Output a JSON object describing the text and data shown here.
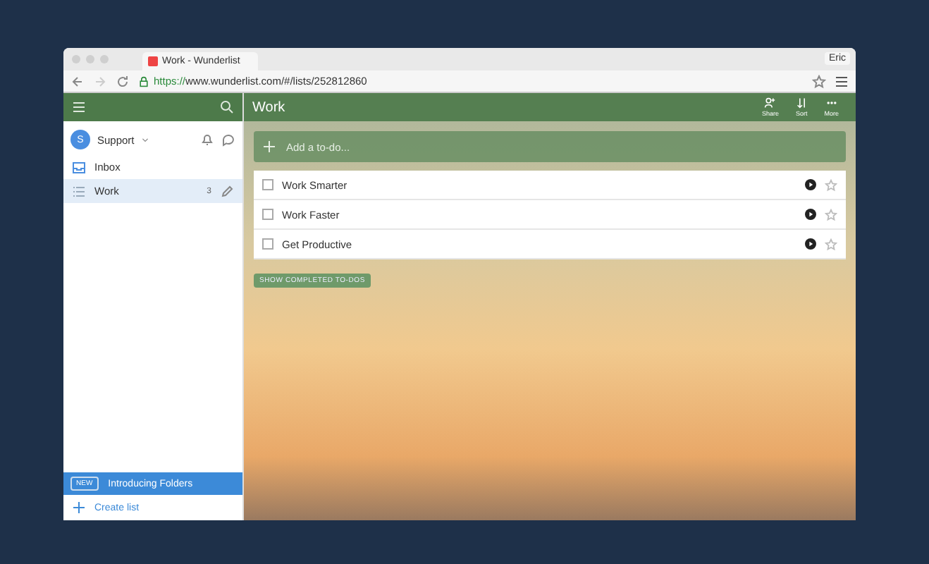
{
  "browser": {
    "tab_title": "Work - Wunderlist",
    "url_scheme": "https://",
    "url_rest": "www.wunderlist.com/#/lists/252812860",
    "user": "Eric"
  },
  "sidebar": {
    "account": {
      "initial": "S",
      "name": "Support"
    },
    "items": [
      {
        "label": "Inbox",
        "kind": "inbox",
        "selected": false
      },
      {
        "label": "Work",
        "kind": "list",
        "count": "3",
        "selected": true
      }
    ],
    "banner": {
      "badge": "NEW",
      "label": "Introducing Folders"
    },
    "create": "Create list"
  },
  "list": {
    "title": "Work",
    "actions": [
      {
        "kind": "share",
        "label": "Share"
      },
      {
        "kind": "sort",
        "label": "Sort"
      },
      {
        "kind": "more",
        "label": "More"
      }
    ],
    "add_placeholder": "Add a to-do...",
    "todos": [
      {
        "title": "Work Smarter",
        "checked": false,
        "starred": false
      },
      {
        "title": "Work Faster",
        "checked": false,
        "starred": false
      },
      {
        "title": "Get Productive",
        "checked": false,
        "starred": false
      }
    ],
    "show_completed": "SHOW COMPLETED TO-DOS"
  }
}
